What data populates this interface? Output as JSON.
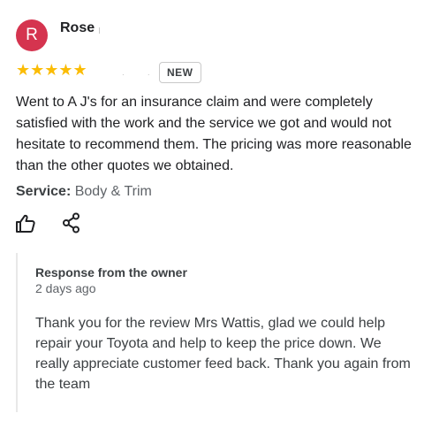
{
  "reviewer": {
    "initial": "R",
    "name": "Rose",
    "avatar_color": "#d5344f"
  },
  "rating": {
    "stars": 5,
    "max": 5,
    "star_glyphs": "★★★★★",
    "star_color": "#fbbc04",
    "badge": "NEW"
  },
  "review": {
    "text": "Went to A J's for an insurance claim and were completely satisfied with the work and the service we got and would not hesitate to recommend them.  The pricing was more reasonable than the other quotes we obtained.",
    "service_label": "Service:",
    "service_value": "Body & Trim"
  },
  "actions": {
    "like_icon": "thumbs-up-icon",
    "share_icon": "share-icon"
  },
  "owner_response": {
    "title": "Response from the owner",
    "date": "2 days ago",
    "text": "Thank you for the review Mrs Wattis, glad we could help repair your Toyota and help to keep the price down. We really appreciate customer feed back. Thank you again from the team"
  }
}
